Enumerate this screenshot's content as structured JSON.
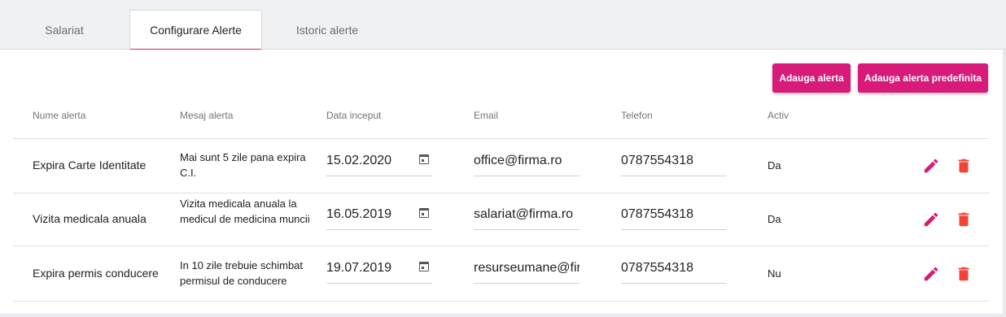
{
  "tabs": [
    {
      "label": "Salariat"
    },
    {
      "label": "Configurare Alerte"
    },
    {
      "label": "Istoric alerte"
    }
  ],
  "buttons": {
    "add_alert": "Adauga alerta",
    "add_predefined": "Adauga alerta predefinita"
  },
  "table": {
    "headers": [
      "Nume alerta",
      "Mesaj alerta",
      "Data inceput",
      "Email",
      "Telefon",
      "Activ"
    ],
    "rows": [
      {
        "name": "Expira Carte Identitate",
        "message": "Mai sunt 5 zile pana expira C.I.",
        "date": "15.02.2020",
        "email": "office@firma.ro",
        "phone": "0787554318",
        "active": "Da"
      },
      {
        "name": "Vizita medicala anuala",
        "message": "Vizita medicala anuala la medicul de medicina muncii",
        "date": "16.05.2019",
        "email": "salariat@firma.ro",
        "phone": "0787554318",
        "active": "Da"
      },
      {
        "name": "Expira permis conducere",
        "message": "In 10 zile trebuie schimbat permisul de conducere",
        "date": "19.07.2019",
        "email": "resurseumane@fir",
        "phone": "0787554318",
        "active": "Nu"
      }
    ]
  },
  "icons": {
    "edit": "pencil-icon",
    "delete": "trash-icon",
    "calendar": "calendar-icon"
  },
  "colors": {
    "accent": "#d81b7a",
    "delete": "#f44336"
  }
}
